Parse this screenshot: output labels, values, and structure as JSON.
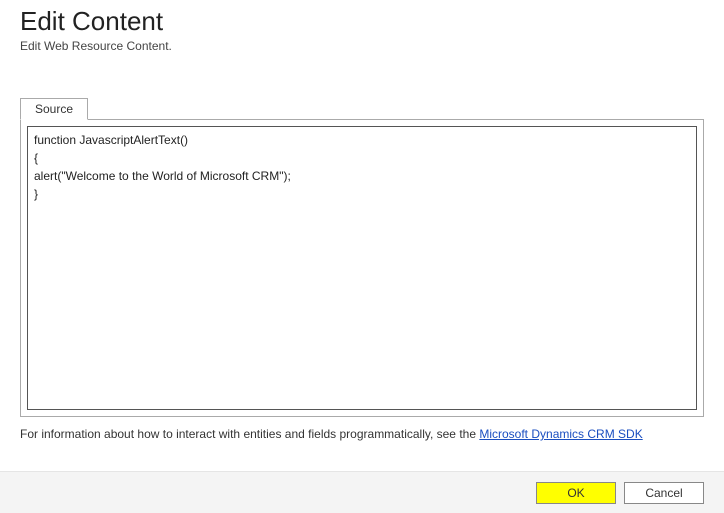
{
  "header": {
    "title": "Edit Content",
    "subtitle": "Edit Web Resource Content."
  },
  "tabs": {
    "source_label": "Source"
  },
  "editor": {
    "code": "function JavascriptAlertText()\n{\nalert(\"Welcome to the World of Microsoft CRM\");\n}"
  },
  "info": {
    "prefix": "For information about how to interact with entities and fields programmatically, see the ",
    "link_text": "Microsoft Dynamics CRM SDK"
  },
  "footer": {
    "ok_label": "OK",
    "cancel_label": "Cancel"
  }
}
